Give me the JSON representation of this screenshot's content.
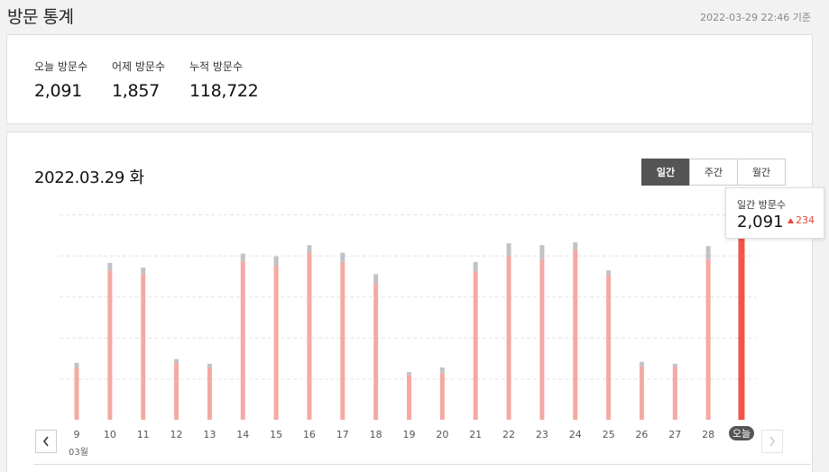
{
  "header": {
    "title": "방문 통계",
    "timestamp": "2022-03-29 22:46 기준"
  },
  "summary": {
    "today": {
      "label": "오늘 방문수",
      "value": "2,091"
    },
    "yesterday": {
      "label": "어제 방문수",
      "value": "1,857"
    },
    "total": {
      "label": "누적 방문수",
      "value": "118,722"
    }
  },
  "chart_header": {
    "date": "2022.03.29 화"
  },
  "period_tabs": [
    {
      "label": "일간",
      "active": true
    },
    {
      "label": "주간",
      "active": false
    },
    {
      "label": "월간",
      "active": false
    }
  ],
  "tooltip": {
    "label": "일간 방문수",
    "value": "2,091",
    "delta": "234"
  },
  "month_label": "03월",
  "icons": {
    "prev": "chevron-left-icon",
    "next": "chevron-right-icon",
    "delta": "triangle-up-icon"
  },
  "colors": {
    "bar": "#f4a9a2",
    "bar_today": "#ef5549",
    "cap": "#c2c2c6",
    "cap_today": "#9a9ba3",
    "today_badge": "#555555",
    "delta": "#e5483a"
  },
  "chart_data": {
    "type": "bar",
    "stacked": true,
    "categories": [
      "9",
      "10",
      "11",
      "12",
      "13",
      "14",
      "15",
      "16",
      "17",
      "18",
      "19",
      "20",
      "21",
      "22",
      "23",
      "24",
      "25",
      "26",
      "27",
      "28",
      "오늘"
    ],
    "series": [
      {
        "values": [
          560,
          1600,
          1560,
          610,
          560,
          1700,
          1650,
          1790,
          1690,
          1460,
          480,
          500,
          1590,
          1760,
          1720,
          1820,
          1550,
          570,
          570,
          1720,
          1940
        ]
      },
      {
        "values": [
          50,
          80,
          70,
          40,
          40,
          80,
          100,
          80,
          100,
          100,
          30,
          60,
          100,
          130,
          150,
          80,
          50,
          50,
          30,
          140,
          151
        ]
      }
    ],
    "ylim": [
      0,
      2200
    ],
    "grid": true,
    "highlight_category": "오늘"
  }
}
